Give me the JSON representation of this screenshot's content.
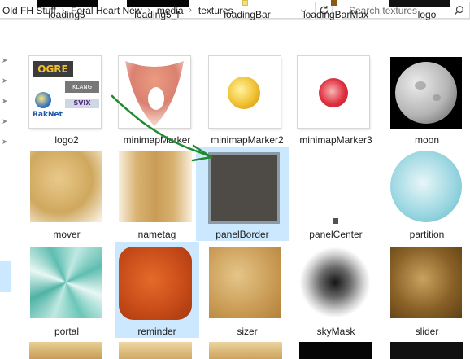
{
  "address_bar": {
    "breadcrumbs": [
      "Old FH Stuff",
      "Feral Heart New",
      "media",
      "textures"
    ],
    "search_placeholder": "Search textures"
  },
  "icons": {
    "dropdown": "chevron-down-icon",
    "refresh": "refresh-icon",
    "search": "search-icon",
    "pin": "pin-icon"
  },
  "colors": {
    "selection": "#cce8ff",
    "arrow": "#1f8a2e"
  },
  "files": [
    {
      "name": "loading5"
    },
    {
      "name": "loading5_f"
    },
    {
      "name": "loadingBar"
    },
    {
      "name": "loadingBarMax"
    },
    {
      "name": "logo"
    },
    {
      "name": "logo2"
    },
    {
      "name": "minimapMarker"
    },
    {
      "name": "minimapMarker2"
    },
    {
      "name": "minimapMarker3"
    },
    {
      "name": "moon"
    },
    {
      "name": "mover"
    },
    {
      "name": "nametag"
    },
    {
      "name": "panelBorder",
      "selected": true
    },
    {
      "name": "panelCenter"
    },
    {
      "name": "partition"
    },
    {
      "name": "portal"
    },
    {
      "name": "reminder",
      "selected": true
    },
    {
      "name": "sizer"
    },
    {
      "name": "skyMask"
    },
    {
      "name": "slider"
    }
  ],
  "logo2_texts": [
    "OGRE",
    "KLANG",
    "SVIX",
    "RakNet"
  ]
}
